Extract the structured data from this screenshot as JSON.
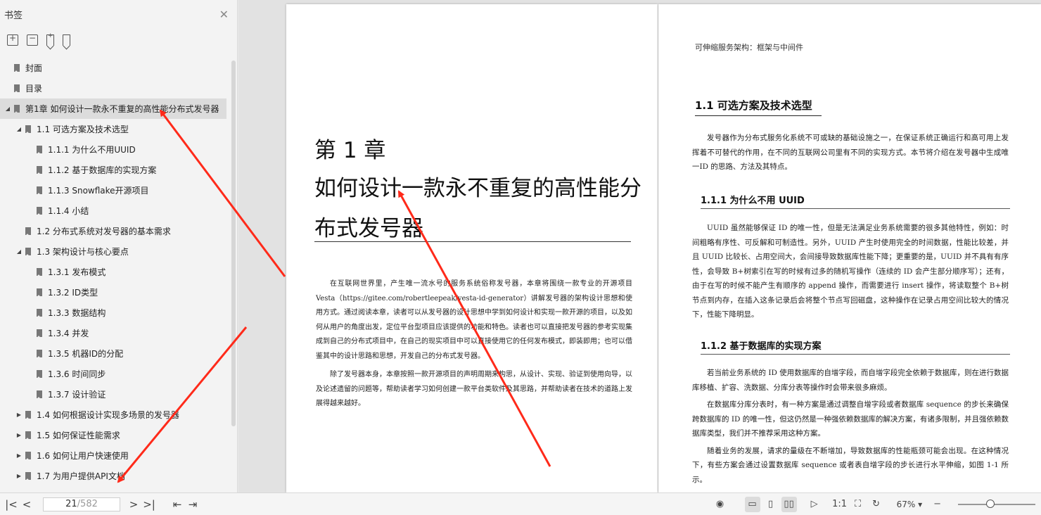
{
  "sidebar": {
    "title": "书签",
    "items": [
      {
        "label": "封面",
        "level": 0,
        "toggle": ""
      },
      {
        "label": "目录",
        "level": 0,
        "toggle": ""
      },
      {
        "label": "第1章 如何设计一款永不重复的高性能分布式发号器",
        "level": 0,
        "toggle": "◢",
        "active": true
      },
      {
        "label": "1.1 可选方案及技术选型",
        "level": 1,
        "toggle": "◢"
      },
      {
        "label": "1.1.1 为什么不用UUID",
        "level": 2,
        "toggle": ""
      },
      {
        "label": "1.1.2 基于数据库的实现方案",
        "level": 2,
        "toggle": ""
      },
      {
        "label": "1.1.3 Snowflake开源项目",
        "level": 2,
        "toggle": ""
      },
      {
        "label": "1.1.4 小结",
        "level": 2,
        "toggle": ""
      },
      {
        "label": "1.2 分布式系统对发号器的基本需求",
        "level": 1,
        "toggle": ""
      },
      {
        "label": "1.3 架构设计与核心要点",
        "level": 1,
        "toggle": "◢"
      },
      {
        "label": "1.3.1 发布模式",
        "level": 2,
        "toggle": ""
      },
      {
        "label": "1.3.2 ID类型",
        "level": 2,
        "toggle": ""
      },
      {
        "label": "1.3.3 数据结构",
        "level": 2,
        "toggle": ""
      },
      {
        "label": "1.3.4 并发",
        "level": 2,
        "toggle": ""
      },
      {
        "label": "1.3.5 机器ID的分配",
        "level": 2,
        "toggle": ""
      },
      {
        "label": "1.3.6 时间同步",
        "level": 2,
        "toggle": ""
      },
      {
        "label": "1.3.7 设计验证",
        "level": 2,
        "toggle": ""
      },
      {
        "label": "1.4 如何根据设计实现多场景的发号器",
        "level": 1,
        "toggle": "▶"
      },
      {
        "label": "1.5 如何保证性能需求",
        "level": 1,
        "toggle": "▶"
      },
      {
        "label": "1.6 如何让用户快速使用",
        "level": 1,
        "toggle": "▶"
      },
      {
        "label": "1.7 为用户提供API文档",
        "level": 1,
        "toggle": "▶"
      }
    ]
  },
  "left_page": {
    "chapter_number": "第 1 章",
    "chapter_title": "如何设计一款永不重复的高性能分布式发号器",
    "intro_paragraphs": [
      "在互联网世界里，产生唯一流水号的服务系统俗称发号器，本章将围绕一款专业的开源项目 Vesta（https://gitee.com/robertleepeak/vesta-id-generator）讲解发号器的架构设计思想和使用方式。通过阅读本章，读者可以从发号器的设计思想中学到如何设计和实现一款开源的项目，以及如何从用户的角度出发，定位平台型项目应该提供的功能和特色。读者也可以直接把发号器的参考实现集成到自己的分布式项目中，在自己的现实项目中可以直接使用它的任何发布模式，即装即用；也可以借鉴其中的设计思路和思想，开发自己的分布式发号器。",
      "除了发号器本身，本章按照一款开源项目的声明周期来构思，从设计、实现、验证到使用向导，以及论述遗留的问题等，帮助读者学习如何创建一款平台类软件及其思路，并帮助读者在技术的道路上发展得越来越好。"
    ]
  },
  "right_page": {
    "running_head": "可伸缩服务架构：框架与中间件",
    "section_title": "1.1  可选方案及技术选型",
    "section_intro": "发号器作为分布式服务化系统不可或缺的基础设施之一，在保证系统正确运行和高可用上发挥着不可替代的作用，在不同的互联网公司里有不同的实现方式。本节将介绍在发号器中生成唯一ID 的思路、方法及其特点。",
    "sub1_title": "1.1.1  为什么不用 UUID",
    "sub1_body": "UUID 虽然能够保证 ID 的唯一性，但是无法满足业务系统需要的很多其他特性，例如：时间粗略有序性、可反解和可制造性。另外，UUID 产生时使用完全的时间数据，性能比较差，并且 UUID 比较长、占用空间大，会间接导致数据库性能下降；更重要的是，UUID 并不具有有序性，会导致 B+树索引在写的时候有过多的随机写操作（连续的 ID 会产生部分顺序写）；还有，由于在写的时候不能产生有顺序的 append 操作，而需要进行 insert 操作，将读取整个 B+树节点到内存，在插入这条记录后会将整个节点写回磁盘，这种操作在记录占用空间比较大的情况下，性能下降明显。",
    "sub2_title": "1.1.2  基于数据库的实现方案",
    "sub2_paragraphs": [
      "若当前业务系统的 ID 使用数据库的自增字段，而自增字段完全依赖于数据库，则在进行数据库移植、扩容、洗数据、分库分表等操作时会带来很多麻烦。",
      "在数据库分库分表时，有一种方案是通过调整自增字段或者数据库 sequence 的步长来确保跨数据库的 ID 的唯一性，但这仍然是一种强依赖数据库的解决方案，有诸多限制，并且强依赖数据库类型，我们并不推荐采用这种方案。",
      "随着业务的发展，请求的量级在不断增加，导致数据库的性能瓶颈可能会出现。在这种情况下，有些方案会通过设置数据库 sequence 或者表自增字段的步长进行水平伸缩，如图 1-1 所示。"
    ]
  },
  "bottombar": {
    "current_page": "21",
    "total_pages": "/582",
    "zoom": "67% ▾"
  },
  "colors": {
    "arrow": "#ff2a1a",
    "sidebar_bg": "#f3f3f3",
    "active_bg": "#dcdcdc"
  }
}
